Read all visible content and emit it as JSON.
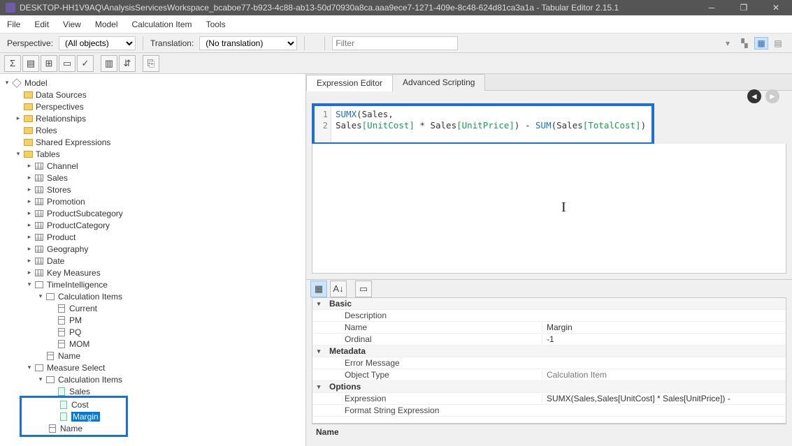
{
  "window": {
    "title": "DESKTOP-HH1V9AQ\\AnalysisServicesWorkspace_bcaboe77-b923-4c88-ab13-50d70930a8ca.aaa9ece7-1271-409e-8c48-624d81ca3a1a - Tabular Editor 2.15.1"
  },
  "menu": {
    "file": "File",
    "edit": "Edit",
    "view": "View",
    "model": "Model",
    "calcitem": "Calculation Item",
    "tools": "Tools"
  },
  "toolbar": {
    "perspective_label": "Perspective:",
    "perspective_value": "(All objects)",
    "translation_label": "Translation:",
    "translation_value": "(No translation)",
    "filter_placeholder": "Filter"
  },
  "tree": {
    "root": "Model",
    "datasources": "Data Sources",
    "perspectives": "Perspectives",
    "relationships": "Relationships",
    "roles": "Roles",
    "shared": "Shared Expressions",
    "tables": "Tables",
    "channel": "Channel",
    "sales": "Sales",
    "stores": "Stores",
    "promotion": "Promotion",
    "productsub": "ProductSubcategory",
    "productcat": "ProductCategory",
    "product": "Product",
    "geography": "Geography",
    "date": "Date",
    "keymeasures": "Key Measures",
    "timeintel": "TimeIntelligence",
    "calcitems1": "Calculation Items",
    "current": "Current",
    "pm": "PM",
    "pq": "PQ",
    "mom": "MOM",
    "name1": "Name",
    "measuresel": "Measure Select",
    "calcitems2": "Calculation Items",
    "sales2": "Sales",
    "cost": "Cost",
    "margin": "Margin",
    "name2": "Name"
  },
  "tabs": {
    "expr": "Expression Editor",
    "adv": "Advanced Scripting"
  },
  "code": {
    "line1_a": "SUMX",
    "line1_b": "(Sales,",
    "line2_a": "Sales",
    "line2_b": "[UnitCost]",
    "line2_c": " * Sales",
    "line2_d": "[UnitPrice]",
    "line2_e": ") - ",
    "line2_f": "SUM",
    "line2_g": "(Sales",
    "line2_h": "[TotalCost]",
    "line2_i": ")"
  },
  "properties": {
    "basic": "Basic",
    "description": "Description",
    "description_val": "",
    "name": "Name",
    "name_val": "Margin",
    "ordinal": "Ordinal",
    "ordinal_val": "-1",
    "metadata": "Metadata",
    "errmsg": "Error Message",
    "errmsg_val": "",
    "objtype": "Object Type",
    "objtype_val": "Calculation Item",
    "options": "Options",
    "expression": "Expression",
    "expression_val": "SUMX(Sales,Sales[UnitCost] * Sales[UnitPrice]) -",
    "fmtexpr": "Format String Expression",
    "fmtexpr_val": ""
  },
  "help": {
    "title": "Name"
  }
}
